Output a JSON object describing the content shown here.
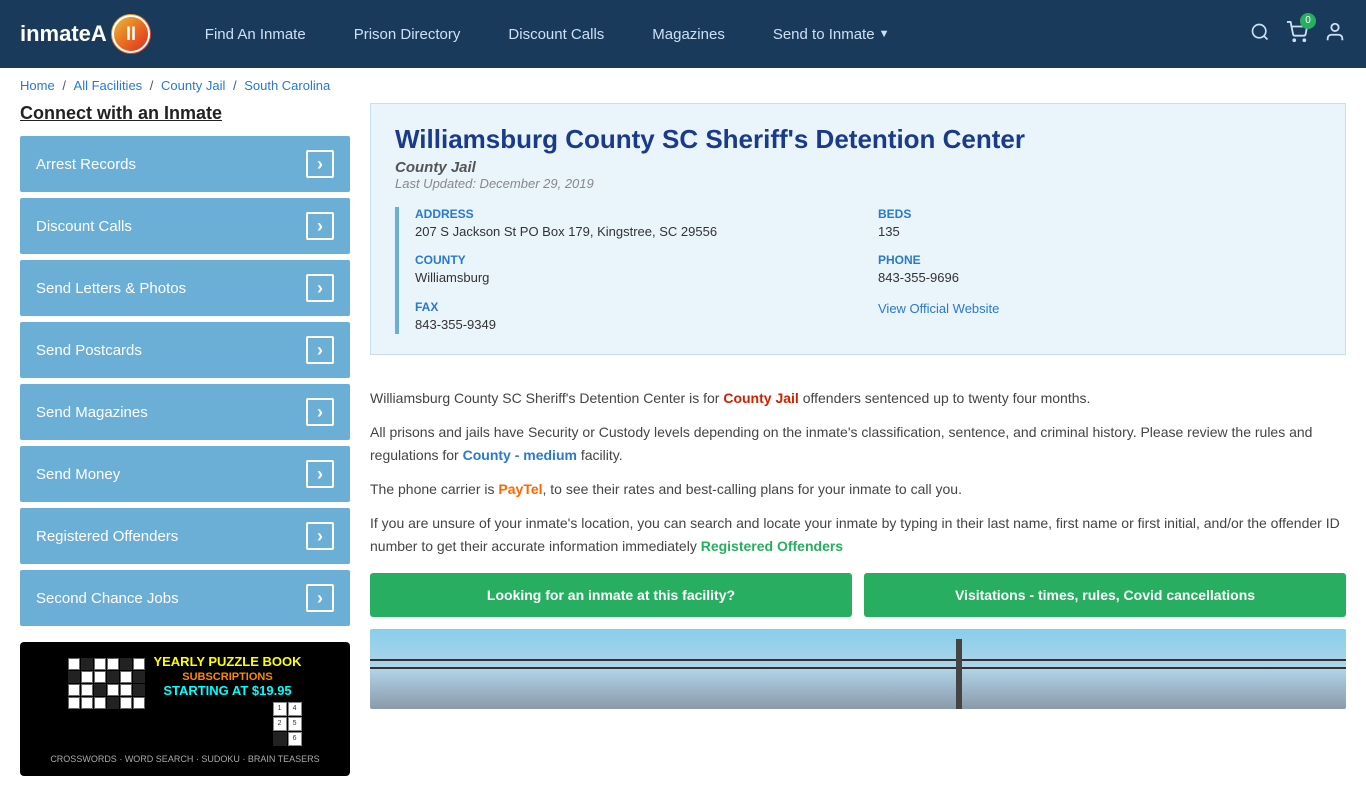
{
  "header": {
    "logo_text": "inmateA",
    "nav": [
      {
        "label": "Find An Inmate",
        "id": "find-inmate"
      },
      {
        "label": "Prison Directory",
        "id": "prison-directory"
      },
      {
        "label": "Discount Calls",
        "id": "discount-calls"
      },
      {
        "label": "Magazines",
        "id": "magazines"
      },
      {
        "label": "Send to Inmate",
        "id": "send-to-inmate",
        "dropdown": true
      }
    ],
    "cart_count": "0"
  },
  "breadcrumb": {
    "items": [
      "Home",
      "All Facilities",
      "County Jail",
      "South Carolina"
    ]
  },
  "sidebar": {
    "title": "Connect with an Inmate",
    "items": [
      {
        "label": "Arrest Records"
      },
      {
        "label": "Discount Calls"
      },
      {
        "label": "Send Letters & Photos"
      },
      {
        "label": "Send Postcards"
      },
      {
        "label": "Send Magazines"
      },
      {
        "label": "Send Money"
      },
      {
        "label": "Registered Offenders"
      },
      {
        "label": "Second Chance Jobs"
      }
    ],
    "ad": {
      "title": "YEARLY PUZZLE BOOK",
      "subtitle": "SUBSCRIPTIONS",
      "price": "STARTING AT $19.95",
      "types": "CROSSWORDS · WORD SEARCH · SUDOKU · BRAIN TEASERS"
    }
  },
  "facility": {
    "name": "Williamsburg County SC Sheriff's Detention Center",
    "type": "County Jail",
    "updated": "Last Updated: December 29, 2019",
    "address_label": "ADDRESS",
    "address_value": "207 S Jackson St PO Box 179, Kingstree, SC 29556",
    "beds_label": "BEDS",
    "beds_value": "135",
    "county_label": "COUNTY",
    "county_value": "Williamsburg",
    "phone_label": "PHONE",
    "phone_value": "843-355-9696",
    "fax_label": "FAX",
    "fax_value": "843-355-9349",
    "website_label": "View Official Website"
  },
  "description": {
    "para1_pre": "Williamsburg County SC Sheriff's Detention Center is for ",
    "para1_link1": "County Jail",
    "para1_post": " offenders sentenced up to twenty four months.",
    "para2_pre": "All prisons and jails have Security or Custody levels depending on the inmate's classification, sentence, and criminal history. Please review the rules and regulations for ",
    "para2_link1": "County - medium",
    "para2_post": " facility.",
    "para3_pre": "The phone carrier is ",
    "para3_link1": "PayTel",
    "para3_post": ", to see their rates and best-calling plans for your inmate to call you.",
    "para4_pre": "If you are unsure of your inmate's location, you can search and locate your inmate by typing in their last name, first name or first initial, and/or the offender ID number to get their accurate information immediately ",
    "para4_link1": "Registered Offenders"
  },
  "buttons": {
    "looking": "Looking for an inmate at this facility?",
    "visitations": "Visitations - times, rules, Covid cancellations"
  }
}
